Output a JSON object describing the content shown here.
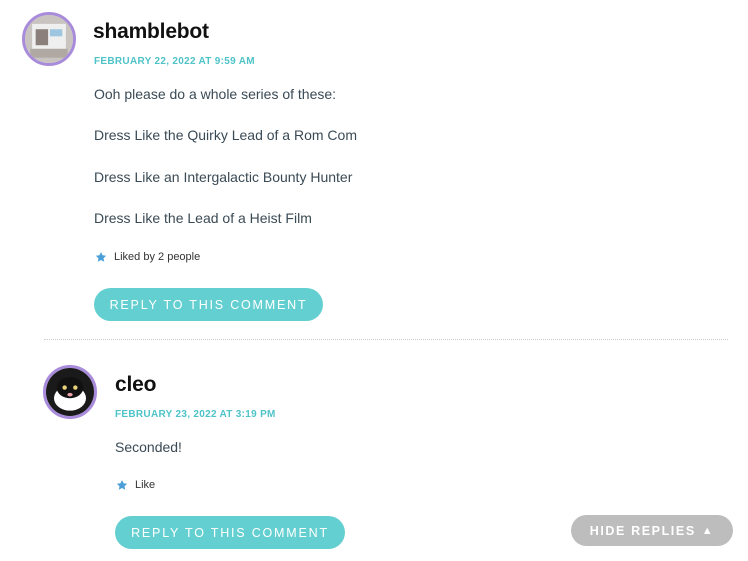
{
  "comments": [
    {
      "author": "shamblebot",
      "date": "FEBRUARY 22, 2022 AT 9:59 AM",
      "paragraphs": [
        "Ooh please do a whole series of these:",
        "Dress Like the Quirky Lead of a Rom Com",
        "Dress Like an Intergalactic Bounty Hunter",
        "Dress Like the Lead of a Heist Film"
      ],
      "likes_text": "Liked by 2 people",
      "reply_label": "REPLY TO THIS COMMENT",
      "avatar_icon": "avatar-image"
    },
    {
      "author": "cleo",
      "date": "FEBRUARY 23, 2022 AT 3:19 PM",
      "paragraphs": [
        "Seconded!"
      ],
      "likes_text": "Like",
      "reply_label": "REPLY TO THIS COMMENT",
      "avatar_icon": "cat-avatar-image"
    }
  ],
  "hide_replies_label": "HIDE REPLIES",
  "hide_replies_icon": "caret-up-icon",
  "like_icon": "star-icon",
  "colors": {
    "accent": "#4ec3c8",
    "button": "#64cfd0",
    "avatar_ring": "#a98bdb",
    "hide_button": "#bdbdbd"
  }
}
